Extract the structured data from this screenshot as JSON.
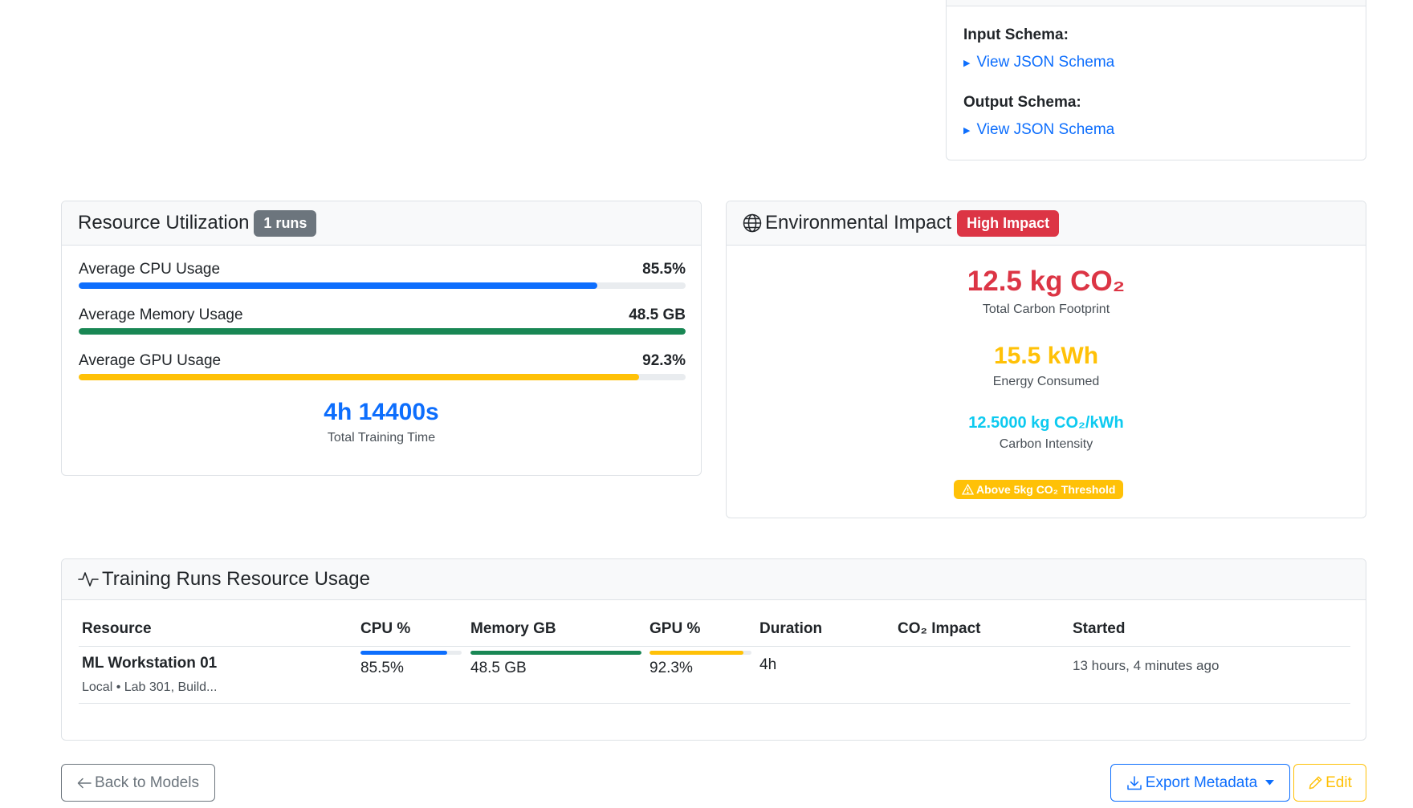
{
  "colors": {
    "primary": "#0d6efd",
    "success": "#198754",
    "warning": "#ffc107",
    "danger": "#dc3545",
    "info": "#0dcaf0",
    "secondary": "#6c757d"
  },
  "schema": {
    "input_label": "Input Schema:",
    "input_link": "View JSON Schema",
    "output_label": "Output Schema:",
    "output_link": "View JSON Schema"
  },
  "resource": {
    "title": "Resource Utilization",
    "runs_badge": "1 runs",
    "metrics": [
      {
        "label": "Average CPU Usage",
        "value": "85.5%",
        "fraction": 0.855,
        "color": "#0d6efd"
      },
      {
        "label": "Average Memory Usage",
        "value": "48.5 GB",
        "fraction": 1.0,
        "color": "#198754"
      },
      {
        "label": "Average GPU Usage",
        "value": "92.3%",
        "fraction": 0.923,
        "color": "#ffc107"
      }
    ],
    "total_time": "4h 14400s",
    "total_time_label": "Total Training Time"
  },
  "env": {
    "title": "Environmental Impact",
    "impact_badge": "High Impact",
    "carbon_value": "12.5 kg CO₂",
    "carbon_label": "Total Carbon Footprint",
    "energy_value": "15.5 kWh",
    "energy_label": "Energy Consumed",
    "intensity_value": "12.5000 kg CO₂/kWh",
    "intensity_label": "Carbon Intensity",
    "threshold_badge": "Above 5kg CO₂ Threshold"
  },
  "runs": {
    "title": "Training Runs Resource Usage",
    "headers": [
      "Resource",
      "CPU %",
      "Memory GB",
      "GPU %",
      "Duration",
      "CO₂ Impact",
      "Started"
    ],
    "rows": [
      {
        "resource": "ML Workstation 01",
        "location": "Local • Lab 301, Build...",
        "cpu": "85.5%",
        "cpu_fraction": 0.855,
        "memory": "48.5 GB",
        "memory_fraction": 1.0,
        "gpu": "92.3%",
        "gpu_fraction": 0.923,
        "duration": "4h",
        "co2_impact": "",
        "started": "13 hours, 4 minutes ago"
      }
    ]
  },
  "footer": {
    "back_label": "Back to Models",
    "export_label": "Export Metadata",
    "edit_label": "Edit"
  }
}
